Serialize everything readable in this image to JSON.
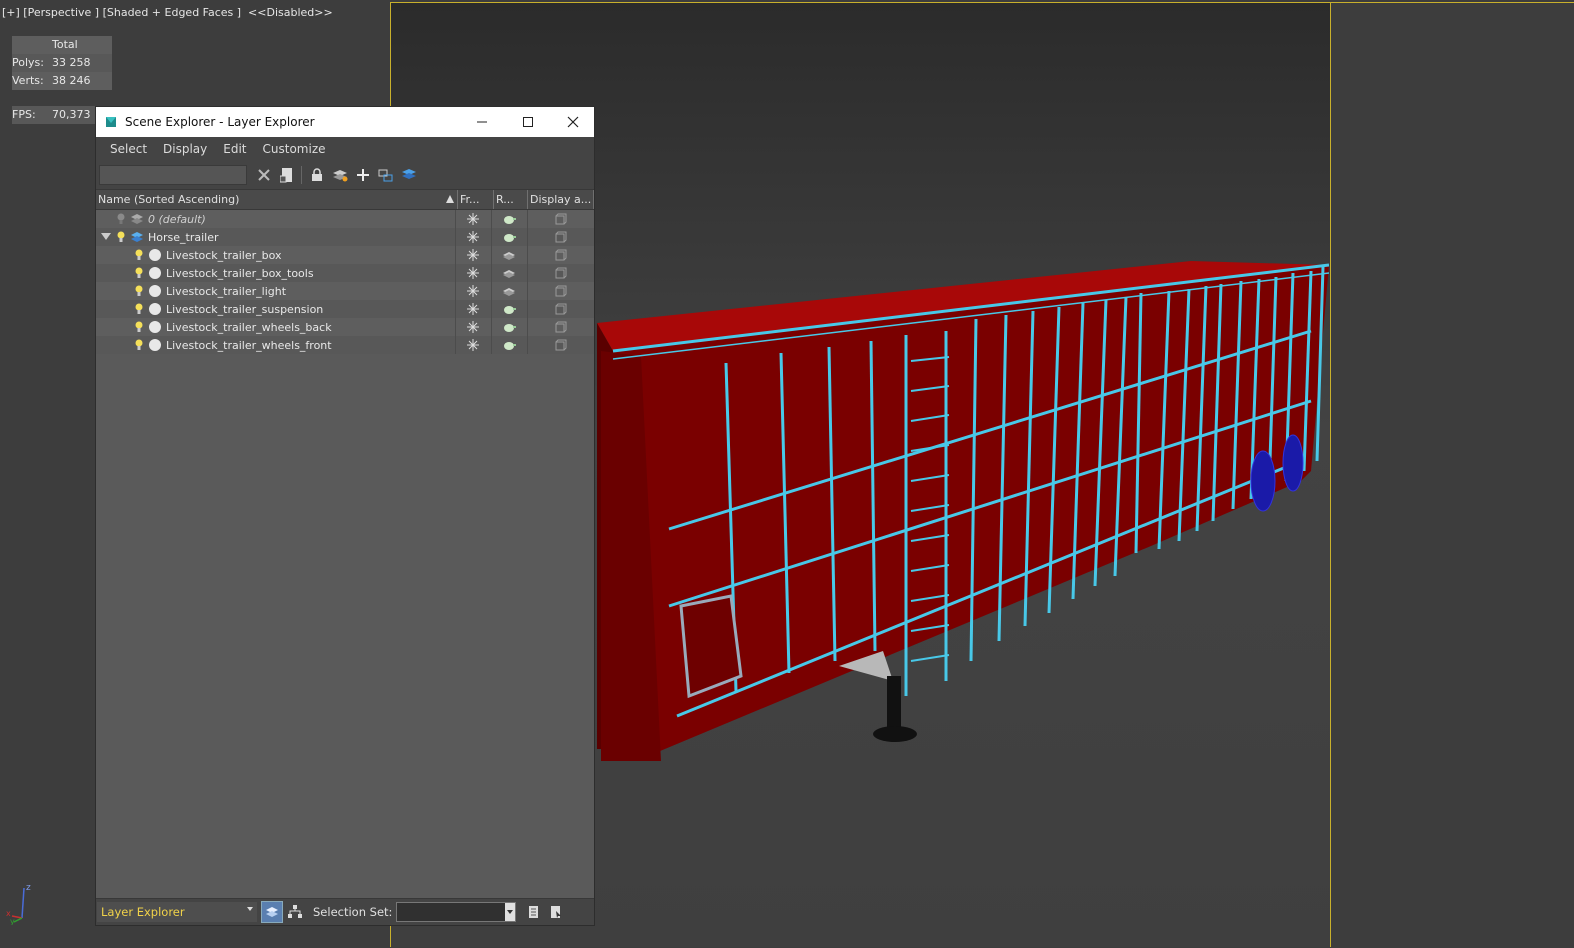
{
  "viewport": {
    "header_label": "[+] [Perspective ] [Shaded + Edged Faces ]  <<Disabled>>",
    "stats": {
      "total_label": "Total",
      "polys_label": "Polys:",
      "polys_value": "33 258",
      "verts_label": "Verts:",
      "verts_value": "38 246",
      "fps_label": "FPS:",
      "fps_value": "70,373"
    },
    "axis_labels": {
      "z": "z",
      "x": "x",
      "y": "y"
    }
  },
  "dialog": {
    "title": "Scene Explorer - Layer Explorer",
    "menu": [
      "Select",
      "Display",
      "Edit",
      "Customize"
    ],
    "search_value": "",
    "columns": {
      "name": "Name (Sorted Ascending)",
      "freeze": "Fr...",
      "render": "R...",
      "display": "Display a..."
    },
    "rows": [
      {
        "name": "0 (default)"
      },
      {
        "name": "Horse_trailer"
      },
      {
        "name": "Livestock_trailer_box"
      },
      {
        "name": "Livestock_trailer_box_tools"
      },
      {
        "name": "Livestock_trailer_light"
      },
      {
        "name": "Livestock_trailer_suspension"
      },
      {
        "name": "Livestock_trailer_wheels_back"
      },
      {
        "name": "Livestock_trailer_wheels_front"
      }
    ],
    "status": {
      "explorer_select": "Layer Explorer",
      "selection_set_label": "Selection Set:",
      "selection_set_value": ""
    }
  },
  "colors": {
    "accent_yellow": "#f0d24a",
    "viewport_border": "#c8b02c",
    "trailer_red": "#8b0000",
    "wire_cyan": "#48c8e8",
    "wheel_blue": "#1a1aa8"
  }
}
